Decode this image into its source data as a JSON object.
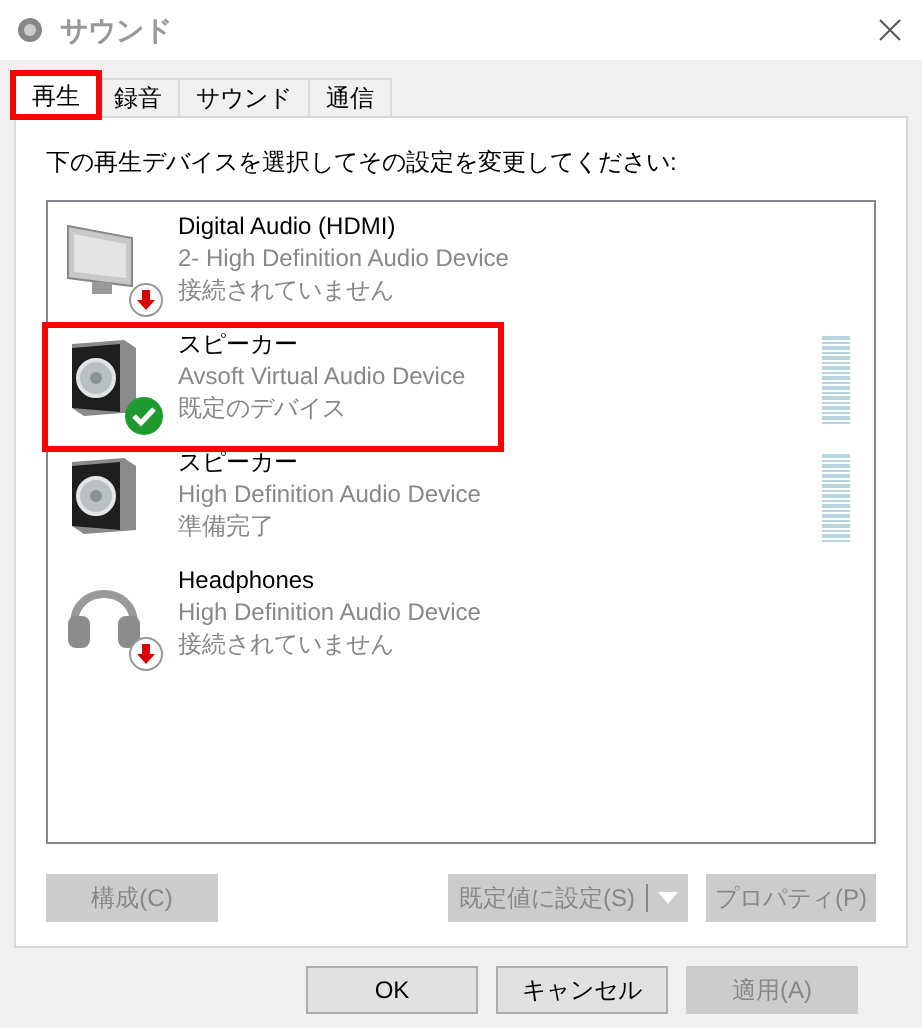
{
  "window": {
    "title": "サウンド"
  },
  "tabs": [
    {
      "label": "再生",
      "selected": true,
      "annotated": true
    },
    {
      "label": "録音",
      "selected": false,
      "annotated": false
    },
    {
      "label": "サウンド",
      "selected": false,
      "annotated": false
    },
    {
      "label": "通信",
      "selected": false,
      "annotated": false
    }
  ],
  "instruction": "下の再生デバイスを選択してその設定を変更してください:",
  "devices": [
    {
      "kind": "monitor",
      "unplugged": true,
      "default": false,
      "name": "Digital Audio (HDMI)",
      "driver": "2- High Definition Audio Device",
      "state": "接続されていません",
      "meter": false,
      "annotated": false
    },
    {
      "kind": "speaker",
      "unplugged": false,
      "default": true,
      "name": "スピーカー",
      "driver": "Avsoft Virtual Audio Device",
      "state": "既定のデバイス",
      "meter": true,
      "annotated": true
    },
    {
      "kind": "speaker",
      "unplugged": false,
      "default": false,
      "name": "スピーカー",
      "driver": "High Definition Audio Device",
      "state": "準備完了",
      "meter": true,
      "annotated": false
    },
    {
      "kind": "headphones",
      "unplugged": true,
      "default": false,
      "name": "Headphones",
      "driver": "High Definition Audio Device",
      "state": "接続されていません",
      "meter": false,
      "annotated": false
    }
  ],
  "panel_buttons": [
    {
      "label": "構成(C)",
      "disabled": true
    },
    {
      "label": "既定値に設定(S)",
      "disabled": true,
      "split": true
    },
    {
      "label": "プロパティ(P)",
      "disabled": true
    }
  ],
  "dialog_buttons": [
    {
      "label": "OK",
      "disabled": false
    },
    {
      "label": "キャンセル",
      "disabled": false
    },
    {
      "label": "適用(A)",
      "disabled": true
    }
  ]
}
